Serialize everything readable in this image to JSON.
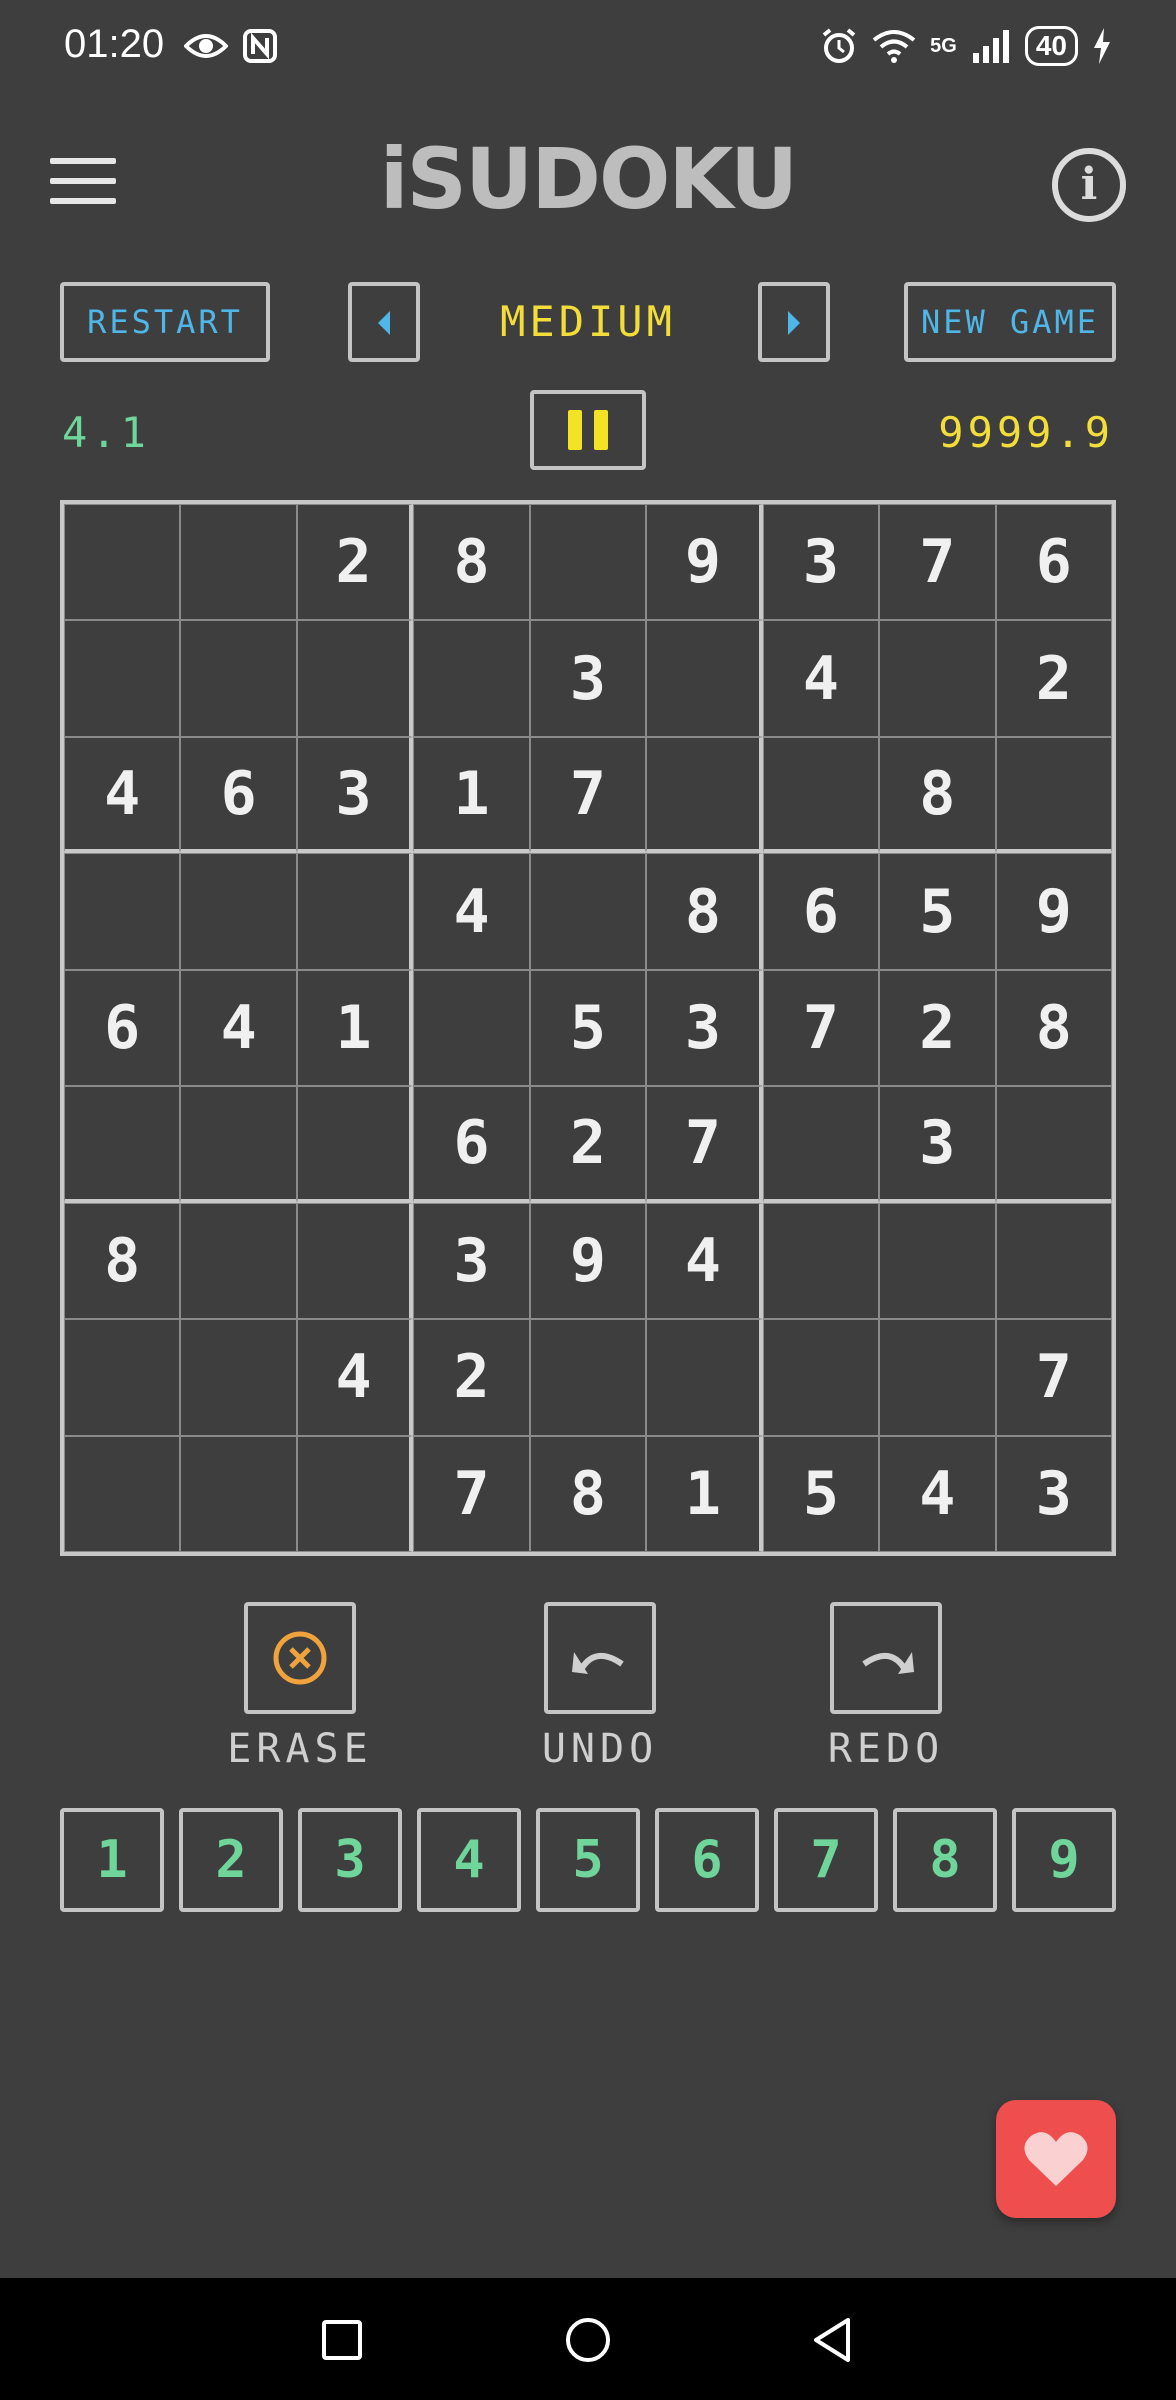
{
  "status_bar": {
    "time": "01:20",
    "left_icons": [
      "eye-icon",
      "nfc-icon"
    ],
    "network_label": "5G",
    "battery": "40",
    "right_icons": [
      "alarm-icon",
      "wifi-icon",
      "signal-icon",
      "battery-icon",
      "charging-icon"
    ]
  },
  "app": {
    "title": "iSUDOKU",
    "menu_icon": "menu-icon",
    "info_icon": "info-icon"
  },
  "controls": {
    "restart_label": "RESTART",
    "difficulty": "MEDIUM",
    "new_game_label": "NEW GAME",
    "prev_icon": "chevron-left-icon",
    "next_icon": "chevron-right-icon"
  },
  "info_row": {
    "left_value": "4.1",
    "right_value": "9999.9",
    "pause_icon": "pause-icon"
  },
  "board": [
    [
      "",
      "",
      "2",
      "8",
      "",
      "9",
      "3",
      "7",
      "6"
    ],
    [
      "",
      "",
      "",
      "",
      "3",
      "",
      "4",
      "",
      "2"
    ],
    [
      "4",
      "6",
      "3",
      "1",
      "7",
      "",
      "",
      "8",
      ""
    ],
    [
      "",
      "",
      "",
      "4",
      "",
      "8",
      "6",
      "5",
      "9"
    ],
    [
      "6",
      "4",
      "1",
      "",
      "5",
      "3",
      "7",
      "2",
      "8"
    ],
    [
      "",
      "",
      "",
      "6",
      "2",
      "7",
      "",
      "3",
      ""
    ],
    [
      "8",
      "",
      "",
      "3",
      "9",
      "4",
      "",
      "",
      ""
    ],
    [
      "",
      "",
      "4",
      "2",
      "",
      "",
      "",
      "",
      "7"
    ],
    [
      "",
      "",
      "",
      "7",
      "8",
      "1",
      "5",
      "4",
      "3"
    ]
  ],
  "tools": {
    "erase_label": "ERASE",
    "undo_label": "UNDO",
    "redo_label": "REDO"
  },
  "numpad": [
    "1",
    "2",
    "3",
    "4",
    "5",
    "6",
    "7",
    "8",
    "9"
  ],
  "colors": {
    "background": "#3e3e3e",
    "accent_blue": "#4fb6e8",
    "accent_yellow": "#f3dd3a",
    "accent_green": "#6fd59a",
    "erase_orange": "#f0a23c",
    "favorite_red": "#ef4e4e"
  },
  "nav": [
    "recents-square-icon",
    "home-circle-icon",
    "back-triangle-icon"
  ]
}
